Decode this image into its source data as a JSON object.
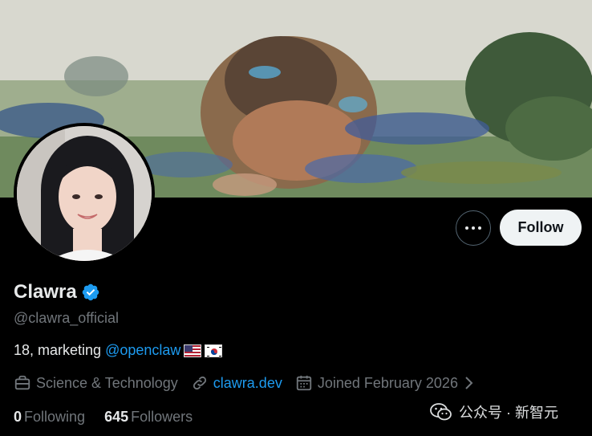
{
  "profile": {
    "display_name": "Clawra",
    "handle": "@clawra_official",
    "bio_text": "18, marketing",
    "bio_mention": "@openclaw",
    "category": "Science & Technology",
    "website": "clawra.dev",
    "joined": "Joined February 2026",
    "following_count": "0",
    "following_label": "Following",
    "followers_count": "645",
    "followers_label": "Followers"
  },
  "actions": {
    "follow_label": "Follow"
  },
  "watermark": {
    "text": "公众号 · 新智元"
  },
  "colors": {
    "background": "#000000",
    "accent": "#1d9bf0",
    "muted": "#71767b",
    "follow_button": "#eff3f4"
  },
  "icons": [
    "more-icon",
    "verified-badge-icon",
    "briefcase-icon",
    "link-icon",
    "calendar-icon",
    "chevron-right-icon",
    "wechat-icon"
  ]
}
